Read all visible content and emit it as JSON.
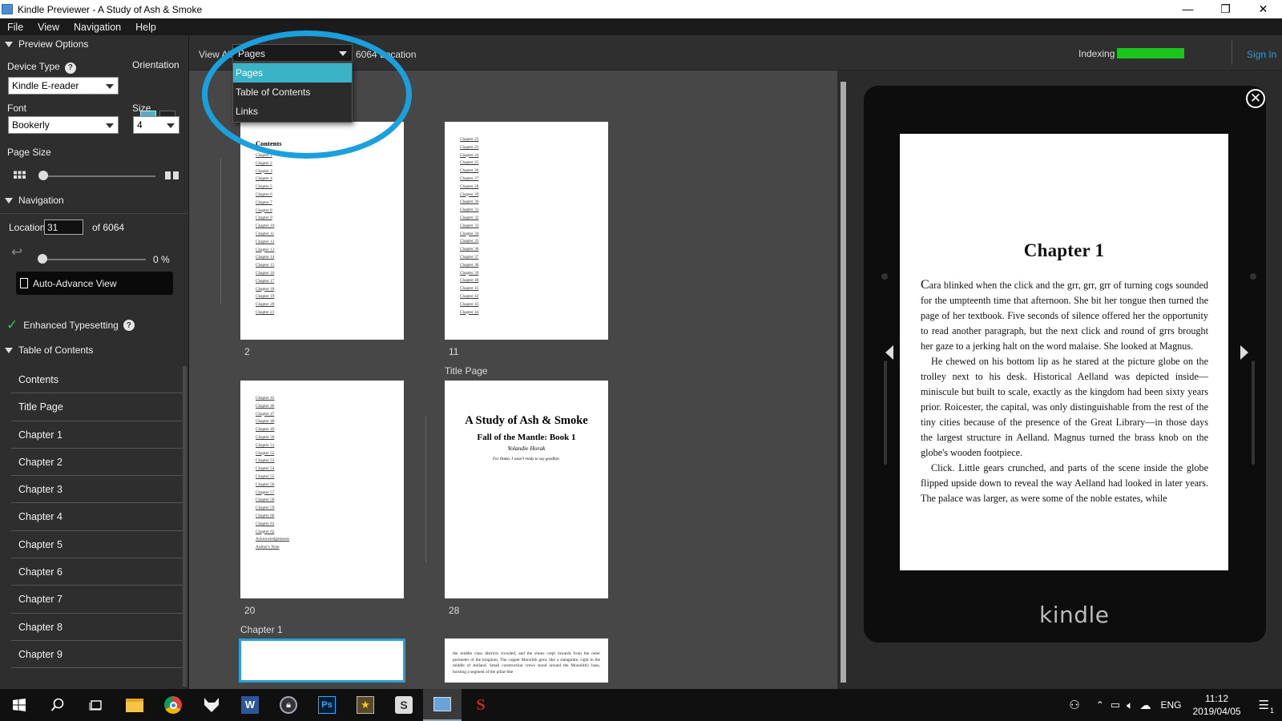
{
  "window": {
    "title": "Kindle Previewer - A Study of Ash & Smoke",
    "minimize": "—",
    "restore": "❐",
    "close": "✕"
  },
  "menu": [
    "File",
    "View",
    "Navigation",
    "Help"
  ],
  "sidebar": {
    "preview_options": "Preview Options",
    "device_type_label": "Device Type",
    "device_type_value": "Kindle E-reader",
    "orientation_label": "Orientation",
    "font_label": "Font",
    "font_value": "Bookerly",
    "size_label": "Size",
    "size_value": "4",
    "page_size_label": "Page Size",
    "navigation_label": "Navigation",
    "location_label": "Location",
    "location_value": "31",
    "location_of": "of 6064",
    "progress_percent": "0 %",
    "auto_advance": "Auto-Advance View",
    "enhanced_typesetting": "Enhanced Typesetting",
    "toc_label": "Table of Contents",
    "toc_items": [
      "Contents",
      "Title Page",
      "Chapter 1",
      "Chapter 2",
      "Chapter 3",
      "Chapter 4",
      "Chapter 5",
      "Chapter 6",
      "Chapter 7",
      "Chapter 8",
      "Chapter 9"
    ]
  },
  "toolbar": {
    "view_all_prefix": "View All",
    "view_select_value": "Pages",
    "location_count_suffix": "6064 Location",
    "indexing_label": "Indexing",
    "indexing_color": "#1bc51b",
    "sign_in": "Sign In"
  },
  "dropdown": {
    "options": [
      "Pages",
      "Table of Contents",
      "Links"
    ],
    "selected": "Pages",
    "highlight_color": "#3ab3c6"
  },
  "thumbnails": {
    "contents_title": "Contents",
    "links_a": [
      "Chapter 1",
      "Chapter 2",
      "Chapter 3",
      "Chapter 4",
      "Chapter 5",
      "Chapter 6",
      "Chapter 7",
      "Chapter 8",
      "Chapter 9",
      "Chapter 10",
      "Chapter 11",
      "Chapter 12",
      "Chapter 13",
      "Chapter 14",
      "Chapter 15",
      "Chapter 16",
      "Chapter 17",
      "Chapter 18",
      "Chapter 19",
      "Chapter 20",
      "Chapter 21"
    ],
    "links_b": [
      "Chapter 22",
      "Chapter 23",
      "Chapter 24",
      "Chapter 25",
      "Chapter 26",
      "Chapter 27",
      "Chapter 28",
      "Chapter 29",
      "Chapter 30",
      "Chapter 31",
      "Chapter 32",
      "Chapter 33",
      "Chapter 34",
      "Chapter 35",
      "Chapter 36",
      "Chapter 37",
      "Chapter 38",
      "Chapter 39",
      "Chapter 40",
      "Chapter 41",
      "Chapter 42",
      "Chapter 43",
      "Chapter 44"
    ],
    "links_c": [
      "Chapter 45",
      "Chapter 46",
      "Chapter 47",
      "Chapter 48",
      "Chapter 49",
      "Chapter 50",
      "Chapter 51",
      "Chapter 52",
      "Chapter 53",
      "Chapter 54",
      "Chapter 55",
      "Chapter 56",
      "Chapter 57",
      "Chapter 58",
      "Chapter 59",
      "Chapter 60",
      "Chapter 61",
      "Chapter 62",
      "Acknowledgements",
      "Author's Note"
    ],
    "page_a": "2",
    "page_b": "11",
    "page_c": "20",
    "page_d": "28",
    "title_page_label": "Title Page",
    "chapter1_label": "Chapter 1",
    "tp_title": "A Study of Ash & Smoke",
    "tp_subtitle": "Fall of the Mantle: Book 1",
    "tp_author": "Yolandie Horak",
    "tp_dedication": "For Ouma. I wasn't ready to say goodbye.",
    "ch_snippet": "the middle class districts crowded, and the slums crept inwards from the outer perimeter of the kingdom. The copper Monolith grew like a stalagmite, right in the middle of Aelland. Small construction crews stood around the Monolith's base, hoisting a segment of the pillar-like"
  },
  "reader": {
    "chapter_title": "Chapter 1",
    "p1_drop": "C",
    "p1": "ara blinked when the click and the grr, grr, grr of turning cogs sounded for the umpteenth time that afternoon. She bit her tongue then turned the page of her textbook. Five seconds of silence offered her the opportunity to read another paragraph, but the next click and round of grrs brought her gaze to a jerking halt on the word malaise. She looked at Magnus.",
    "p2": "He chewed on his bottom lip as he stared at the picture globe on the trolley next to his desk. Historical Aelland was depicted inside—miniscule but built to scale, exactly as the kingdom had been sixty years prior. Roicester, the capital, was only distinguishable from the rest of the tiny cities because of the presence of the Great Library—in those days the largest structure in Aelland. Magnus turned the brass knob on the globe's wooden footpiece.",
    "p3": "Click. Little gears crunched, and parts of the scene inside the globe flipped upside down to reveal the way Aelland had looked in later years. The palace was larger, as were some of the noble estates, while",
    "brand": "kindle",
    "close": "✕"
  },
  "taskbar": {
    "apps": [
      "windows-start",
      "search",
      "task-view",
      "file-explorer",
      "chrome",
      "fox-app",
      "word",
      "vpn",
      "photoshop",
      "game-app",
      "scrivener-app",
      "kindle-previewer",
      "scribd-app"
    ],
    "lang": "ENG",
    "time": "11:12",
    "date": "2019/04/05",
    "notif_count": "1"
  }
}
